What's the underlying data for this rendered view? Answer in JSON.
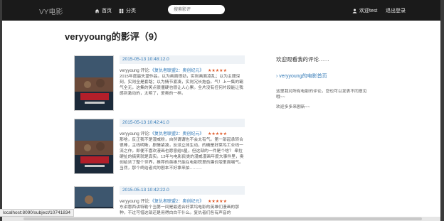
{
  "navbar": {
    "brand": "VY电影",
    "home": "首页",
    "category": "分类",
    "search_placeholder": "搜索影评",
    "user": "欢迎test",
    "logout": "退出登录"
  },
  "page_title": "veryyoung的影评（9）",
  "reviews": [
    {
      "date": "2015-05-13 10:48:12.0",
      "user": "veryyoung",
      "action": "评论:",
      "movie": "《复仇者联盟2：奥创纪元》",
      "stars": "★★★★★",
      "body": "2015年度最失望作品。以为画面很劲，实则画面凌乱；以为主题深刻，实则全是套路；以为情节紧凑，实则冗长拖沓。气！上一集的霸气全无，这集的笑点很僵硬也很让人心累。全片没有任何片段能让我感到激动的，太明了，爱奥的一样。"
    },
    {
      "date": "2015-05-13 10:42:41.0",
      "user": "veryyoung",
      "action": "评论:",
      "movie": "《复仇者联盟2：奥创纪元》",
      "stars": "★★★★★",
      "body": "那啥，反正我不是漫威粉，自然谓谓也不会太有气。第一部起承转合很棒，主线明晰，剧情紧凑，反派立体生动，的确是好莱坞工业线一流之作，即便不喜欢漫画也愿意给5星，但这部的一件是个啥？ 牵拉硬扯的搞笑就是真实。13年与电影民类的漫威漫画年度大事件里，奥创给浓了整个世界，推荐的英雄只能在电影院里的廉价版里面喘气。当然，那个终结者式的剧本不好拿来拍………"
    },
    {
      "date": "2015-05-13 10:42:22.0",
      "user": "veryyoung",
      "action": "评论:",
      "movie": "《复仇者联盟2：奥创纪元》",
      "stars": "★★★★★",
      "body": "东讲惠西讲特勒个当第一间是最适合好莱坞电影的英雄们漫画的那种，不过可惜这部还是用得白白干什么。复仇者们各有声音的"
    }
  ],
  "sidebar": {
    "welcome": "欢迎观看我的评论……",
    "link": "veryyoung的电影首页",
    "note": "这里我对所有电影的评论，您也可以发表不同意见哦~~",
    "note2": "欢迎多多来剧新~~"
  },
  "status_url": "localhost:8090/subject/10741834",
  "colors": {
    "navbar": "#1a1a1a",
    "link": "#337ab7",
    "stars": "#e05a28"
  }
}
